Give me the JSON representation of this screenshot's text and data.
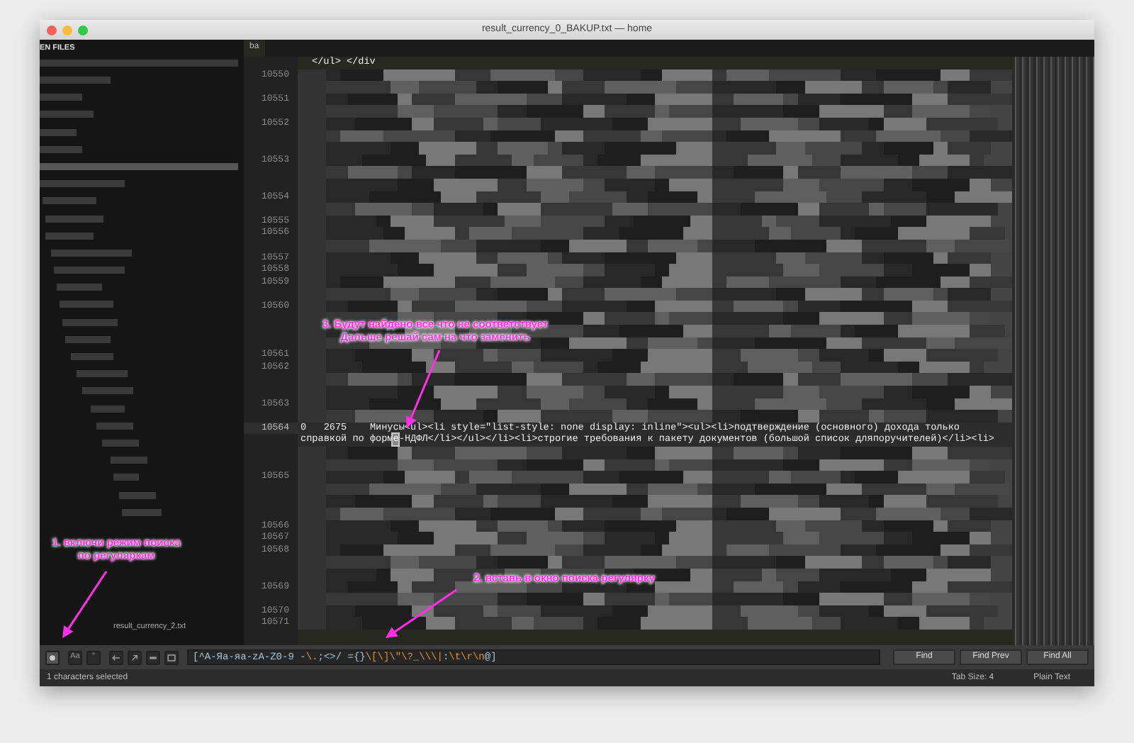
{
  "window": {
    "title": "result_currency_0_BAKUP.txt — home"
  },
  "sidebar": {
    "header": "EN FILES",
    "visible_file": "result_currency_2.txt"
  },
  "tabs": [
    {
      "label": "ba",
      "selected": true
    }
  ],
  "editor": {
    "top_fragment": "</ul> </div",
    "lines": [
      {
        "number": "10550",
        "current": false
      },
      {
        "number": "10551",
        "current": false
      },
      {
        "number": "10552",
        "current": false
      },
      {
        "number": "10553",
        "current": false
      },
      {
        "number": "10554",
        "current": false
      },
      {
        "number": "10555",
        "current": false
      },
      {
        "number": "10556",
        "current": false
      },
      {
        "number": "10557",
        "current": false
      },
      {
        "number": "10558",
        "current": false
      },
      {
        "number": "10559",
        "current": false
      },
      {
        "number": "10560",
        "current": false
      },
      {
        "number": "10561",
        "current": false
      },
      {
        "number": "10562",
        "current": false
      },
      {
        "number": "10563",
        "current": false
      },
      {
        "number": "10564",
        "current": true,
        "text": [
          "0   2675    Минусы<ul><li style=\"list-style: none display: inline\"><ul><li>подтверждение (основного) дохода только",
          [
            {
              "text": "справкой по форм",
              "selected": false
            },
            {
              "text": "e",
              "selected": true
            },
            {
              "text": "-НДФЛ</li></ul></li><li>строгие требования к пакету документов (большой список дляпоручителей)</li><li>",
              "selected": false
            }
          ]
        ]
      },
      {
        "number": "10565",
        "current": false
      },
      {
        "number": "10566",
        "current": false
      },
      {
        "number": "10567",
        "current": false
      },
      {
        "number": "10568",
        "current": false
      },
      {
        "number": "10569",
        "current": false
      },
      {
        "number": "10570",
        "current": false
      },
      {
        "number": "10571",
        "current": false
      }
    ]
  },
  "find_bar": {
    "toggles": [
      {
        "kind": "regex",
        "on": true
      },
      {
        "kind": "case",
        "on": false,
        "label": "Aa"
      },
      {
        "kind": "word",
        "on": false,
        "label": "“"
      },
      {
        "kind": "reverse",
        "on": false
      },
      {
        "kind": "wrap",
        "on": false
      },
      {
        "kind": "selection",
        "on": false
      },
      {
        "kind": "highlight",
        "on": false
      }
    ],
    "query": [
      {
        "kind": "plain",
        "text": "[^А-Яа-яa-zA-Z0-9 -"
      },
      {
        "kind": "escape",
        "text": "\\."
      },
      {
        "kind": "plain",
        "text": ";<>/ ={}"
      },
      {
        "kind": "escape",
        "text": "\\[\\]\\\"\\?_\\\\\\|"
      },
      {
        "kind": "plain",
        "text": ":"
      },
      {
        "kind": "escape",
        "text": "\\t\\r\\n"
      },
      {
        "kind": "plain",
        "text": "@]"
      }
    ],
    "buttons": [
      "Find",
      "Find Prev",
      "Find All"
    ]
  },
  "status_bar": {
    "selection": "1 characters selected",
    "tab_size": "Tab Size: 4",
    "syntax": "Plain Text"
  },
  "annotations": [
    {
      "text": "1. включи режим поиска по регуляркам"
    },
    {
      "text": "2. вставь в окно поиска регулярку"
    },
    {
      "text": "3. Будут найдено все что не соответствует Дальше решай сам на что заменить"
    }
  ]
}
